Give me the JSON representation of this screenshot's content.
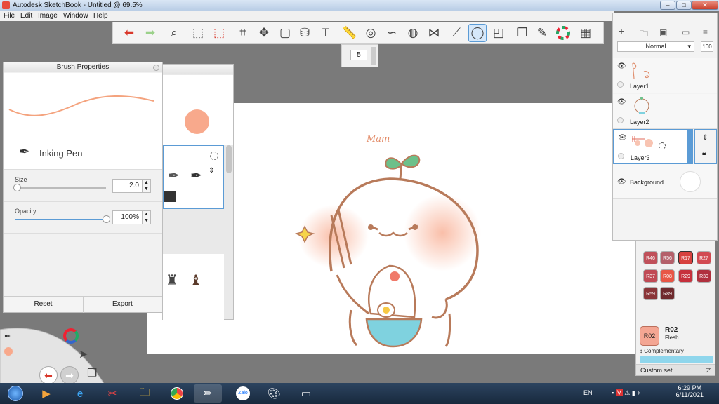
{
  "window": {
    "title": "Autodesk SketchBook - Untitled @ 69.5%",
    "minimize": "–",
    "maximize": "□",
    "close": "✕"
  },
  "menu": [
    "File",
    "Edit",
    "Image",
    "Window",
    "Help"
  ],
  "toolbar": {
    "brush_size": "5"
  },
  "brush_properties": {
    "title": "Brush Properties",
    "brush_name": "Inking Pen",
    "size_label": "Size",
    "size_value": "2.0",
    "size_fraction": 0.02,
    "opacity_label": "Opacity",
    "opacity_value": "100%",
    "opacity_fraction": 1.0,
    "reset_label": "Reset",
    "export_label": "Export"
  },
  "layers": {
    "blend_mode": "Normal",
    "opacity": "100",
    "items": [
      {
        "name": "Layer1"
      },
      {
        "name": "Layer2"
      },
      {
        "name": "Layer3"
      },
      {
        "name": "Background"
      }
    ]
  },
  "copic": {
    "chips": [
      {
        "code": "R46",
        "color": "#c0505a"
      },
      {
        "code": "R56",
        "color": "#b4606a"
      },
      {
        "code": "R17",
        "color": "#d7413e"
      },
      {
        "code": "R27",
        "color": "#d24a52"
      },
      {
        "code": "R37",
        "color": "#c04a55"
      },
      {
        "code": "R08",
        "color": "#e85646"
      },
      {
        "code": "R29",
        "color": "#c6303c"
      },
      {
        "code": "R39",
        "color": "#b0303e"
      },
      {
        "code": "R59",
        "color": "#8a3538"
      },
      {
        "code": "R89",
        "color": "#6f2a2e"
      }
    ],
    "current_code": "R02",
    "current_name": "Flesh",
    "complementary_label": "↕ Complementary",
    "custom_set_label": "Custom set"
  },
  "taskbar": {
    "lang": "EN",
    "time": "6:29 PM",
    "date": "6/11/2021"
  },
  "canvas": {
    "signature": "Mam"
  }
}
